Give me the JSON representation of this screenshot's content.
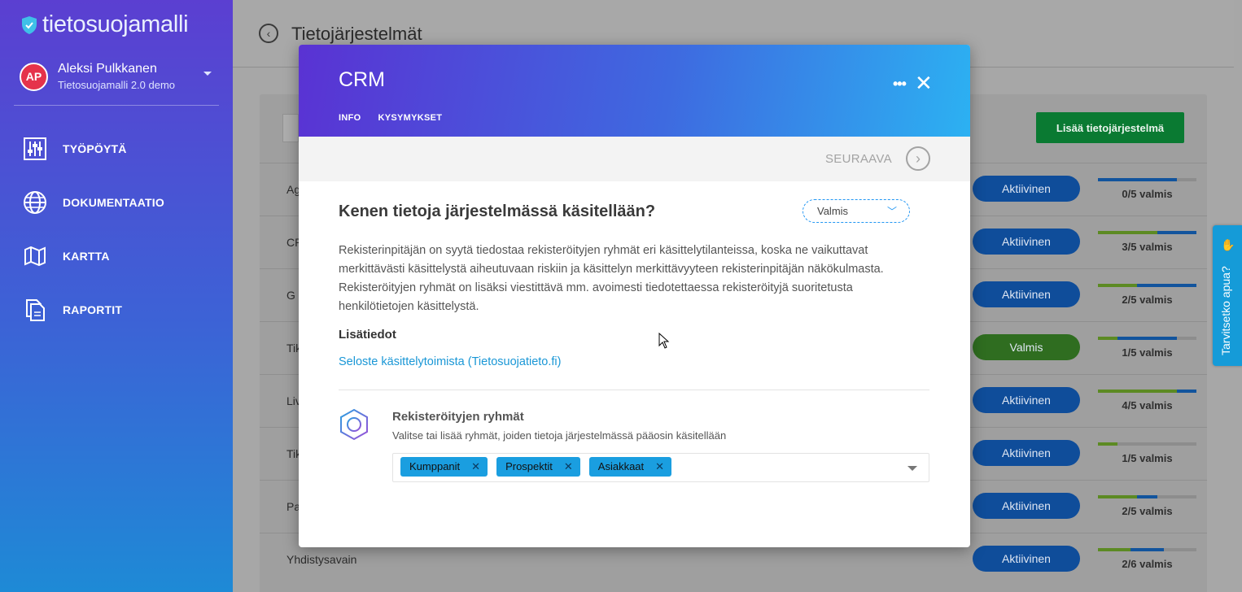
{
  "sidebar": {
    "logo_text": "tietosuojamalli",
    "user": {
      "initials": "AP",
      "name": "Aleksi Pulkkanen",
      "org": "Tietosuojamalli 2.0 demo"
    },
    "items": [
      {
        "label": "TYÖPÖYTÄ",
        "icon": "sliders-icon"
      },
      {
        "label": "DOKUMENTAATIO",
        "icon": "globe-icon"
      },
      {
        "label": "KARTTA",
        "icon": "map-icon"
      },
      {
        "label": "RAPORTIT",
        "icon": "documents-icon"
      }
    ]
  },
  "page": {
    "title": "Tietojärjestelmät",
    "add_button": "Lisää tietojärjestelmä",
    "rows": [
      {
        "name": "Ag",
        "status": "Aktiivinen",
        "progress": "0/5 valmis"
      },
      {
        "name": "CR",
        "status": "Aktiivinen",
        "progress": "3/5 valmis"
      },
      {
        "name": "G",
        "status": "Aktiivinen",
        "progress": "2/5 valmis"
      },
      {
        "name": "Tik",
        "status": "Valmis",
        "progress": "1/5 valmis"
      },
      {
        "name": "Liv",
        "status": "Aktiivinen",
        "progress": "4/5 valmis"
      },
      {
        "name": "Tik",
        "status": "Aktiivinen",
        "progress": "1/5 valmis"
      },
      {
        "name": "Pa",
        "status": "Aktiivinen",
        "progress": "2/5 valmis"
      },
      {
        "name": "Yhdistysavain",
        "status": "Aktiivinen",
        "progress": "2/6 valmis"
      }
    ]
  },
  "help": {
    "label": "Tarvitsetko apua?"
  },
  "modal": {
    "title": "CRM",
    "tabs": [
      "INFO",
      "KYSYMYKSET"
    ],
    "next_label": "SEURAAVA",
    "question": "Kenen tietoja järjestelmässä käsitellään?",
    "state_value": "Valmis",
    "description": "Rekisterinpitäjän on syytä tiedostaa rekisteröityjen ryhmät eri käsittelytilanteissa, koska ne vaikuttavat merkittävästi käsittelystä aiheutuvaan riskiin ja käsittelyn merkittävyyteen rekisterinpitäjän näkökulmasta. Rekisteröityjen ryhmät on lisäksi viestittävä mm. avoimesti tiedotettaessa rekisteröityjä suoritetusta henkilötietojen käsittelystä.",
    "more_heading": "Lisätiedot",
    "link_text": "Seloste käsittelytoimista (Tietosuojatieto.fi)",
    "group_title": "Rekisteröityjen ryhmät",
    "group_subtitle": "Valitse tai lisää ryhmät, joiden tietoja järjestelmässä pääosin käsitellään",
    "tags": [
      "Kumppanit",
      "Prospektit",
      "Asiakkaat"
    ]
  }
}
